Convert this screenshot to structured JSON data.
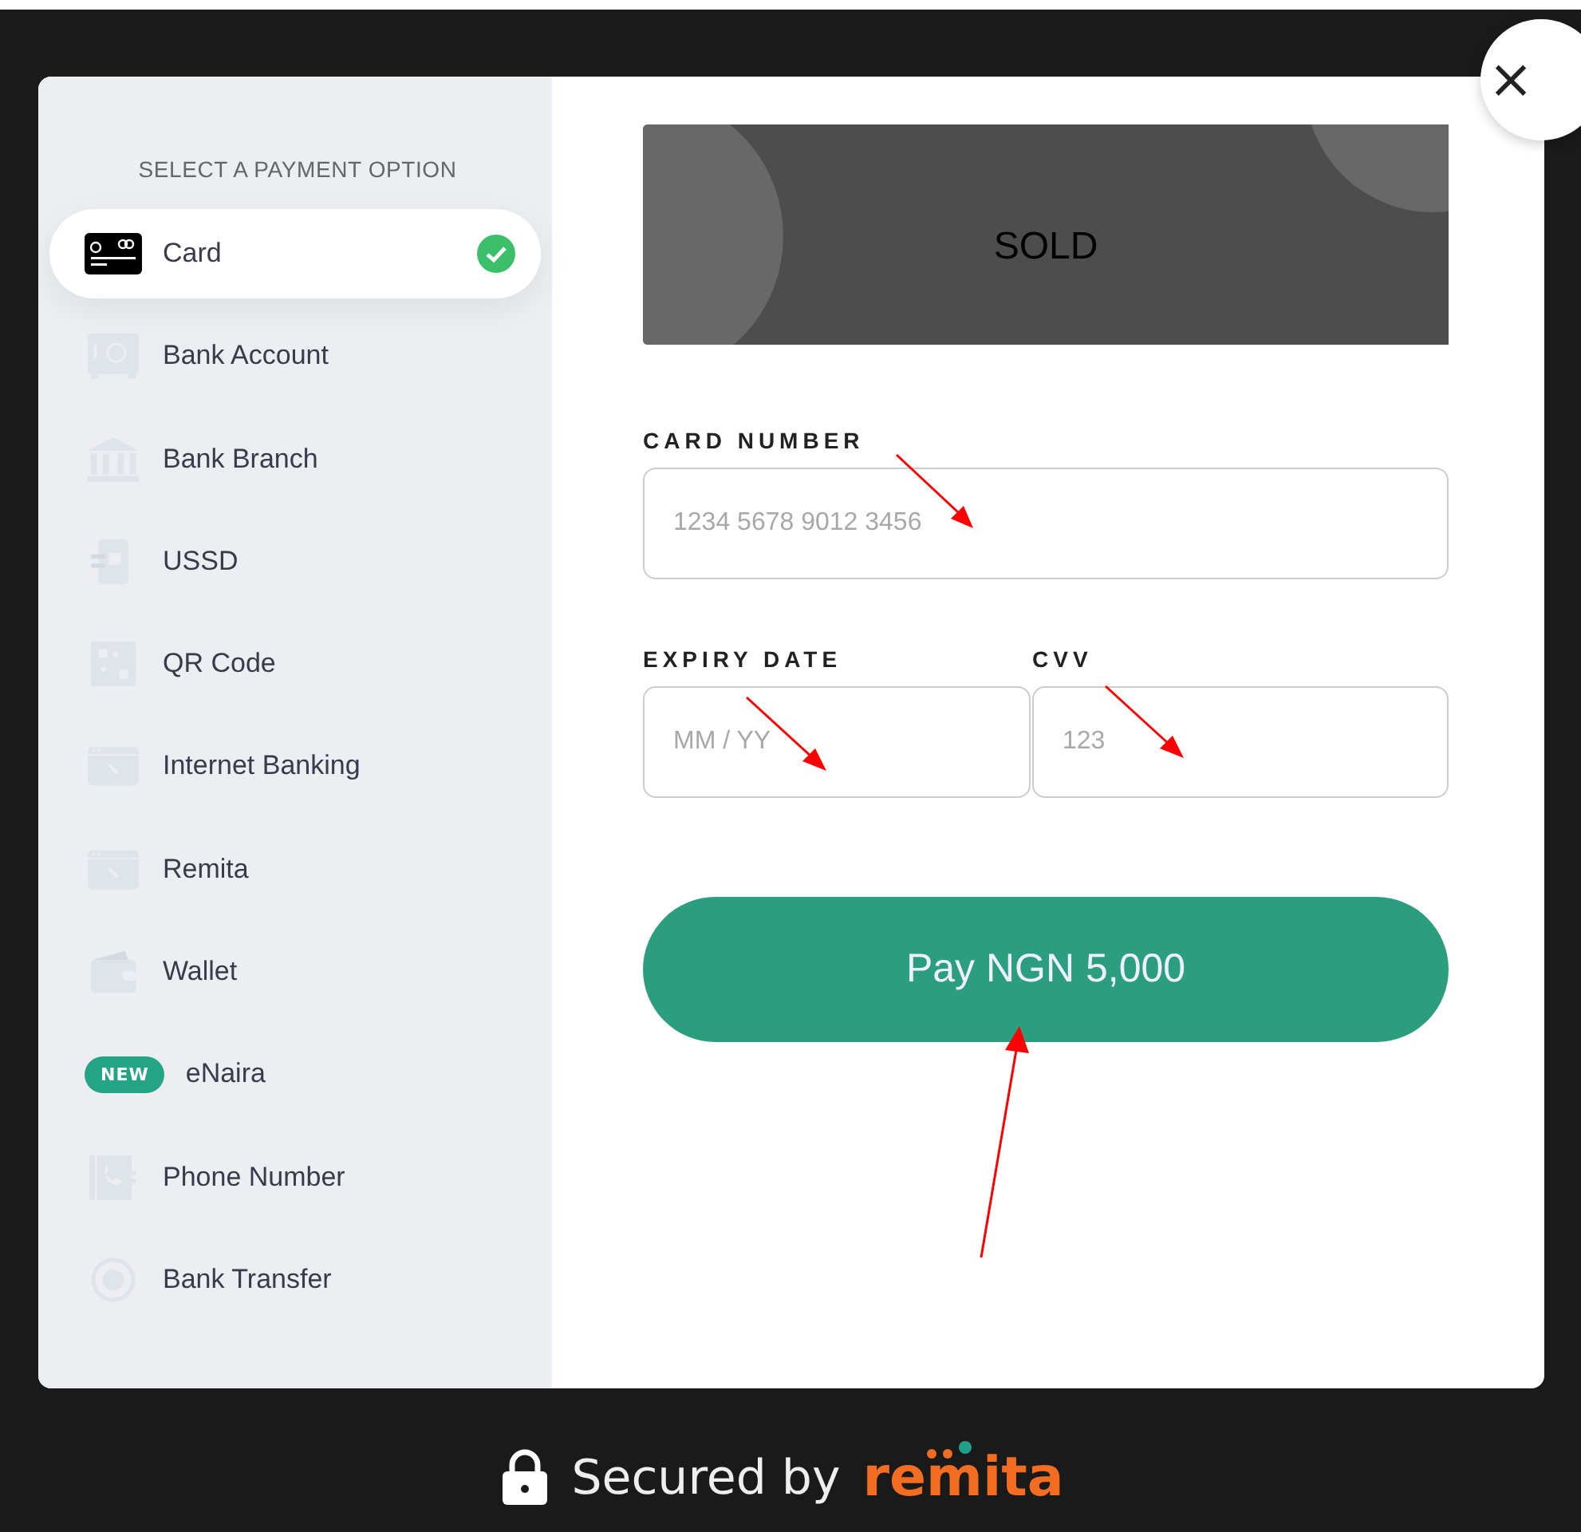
{
  "modal": {
    "sidebar": {
      "heading": "SELECT A PAYMENT OPTION",
      "items": [
        {
          "label": "Card",
          "kind": "card",
          "selected": true
        },
        {
          "label": "Bank Account",
          "kind": "safe",
          "selected": false
        },
        {
          "label": "Bank Branch",
          "kind": "bank",
          "selected": false
        },
        {
          "label": "USSD",
          "kind": "ussd",
          "selected": false
        },
        {
          "label": "QR Code",
          "kind": "qr",
          "selected": false
        },
        {
          "label": "Internet Banking",
          "kind": "browser",
          "selected": false
        },
        {
          "label": "Remita",
          "kind": "browser",
          "selected": false
        },
        {
          "label": "Wallet",
          "kind": "wallet",
          "selected": false
        },
        {
          "label": "eNaira",
          "kind": "badge",
          "badge": "NEW",
          "selected": false
        },
        {
          "label": "Phone Number",
          "kind": "phone",
          "selected": false
        },
        {
          "label": "Bank Transfer",
          "kind": "transfer",
          "selected": false
        }
      ]
    },
    "banner": {
      "text": "SOLD"
    },
    "field_rows": [
      [
        {
          "label": "CARD NUMBER",
          "placeholder": "1234 5678 9012 3456"
        }
      ],
      [
        {
          "label": "EXPIRY DATE",
          "placeholder": "MM / YY"
        },
        {
          "label": "CVV",
          "placeholder": "123"
        }
      ]
    ],
    "pay_button": "Pay NGN 5,000"
  },
  "close_button": "×",
  "footer": {
    "text": "Secured by",
    "brand": "remita"
  }
}
